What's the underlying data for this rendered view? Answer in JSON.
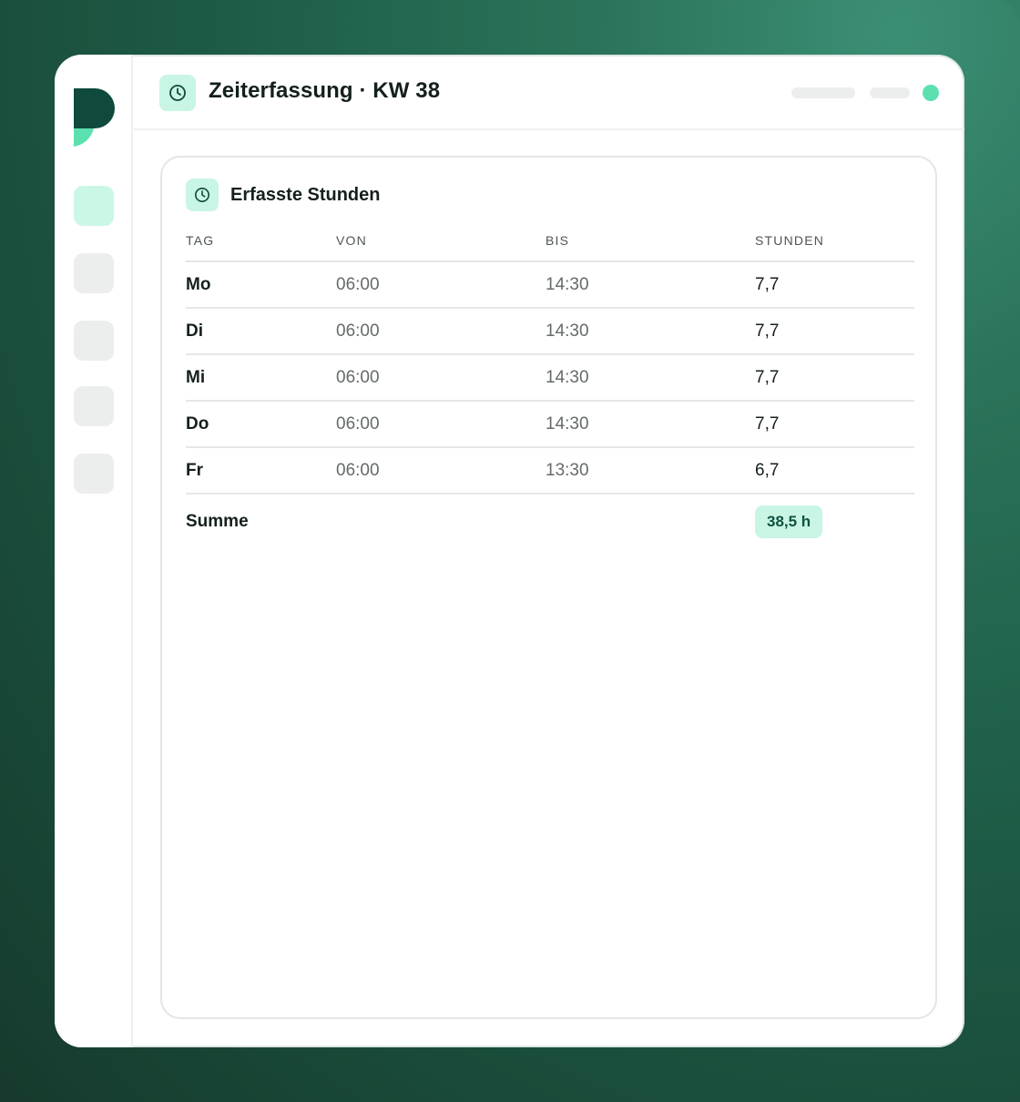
{
  "header": {
    "title": "Zeiterfassung · KW 38",
    "icon": "clock-icon",
    "status_color": "#5de0b0"
  },
  "card": {
    "title": "Erfasste Stunden",
    "icon": "clock-icon",
    "columns": [
      "TAG",
      "VON",
      "BIS",
      "STUNDEN"
    ],
    "rows": [
      {
        "day": "Mo",
        "from": "06:00",
        "to": "14:30",
        "hours": "7,7"
      },
      {
        "day": "Di",
        "from": "06:00",
        "to": "14:30",
        "hours": "7,7"
      },
      {
        "day": "Mi",
        "from": "06:00",
        "to": "14:30",
        "hours": "7,7"
      },
      {
        "day": "Do",
        "from": "06:00",
        "to": "14:30",
        "hours": "7,7"
      },
      {
        "day": "Fr",
        "from": "06:00",
        "to": "13:30",
        "hours": "6,7"
      }
    ],
    "sum_label": "Summe",
    "sum_value": "38,5 h"
  },
  "colors": {
    "accent": "#5de0b0",
    "accent_light": "#c9f5e5",
    "brand_dark": "#0f4a3c"
  }
}
